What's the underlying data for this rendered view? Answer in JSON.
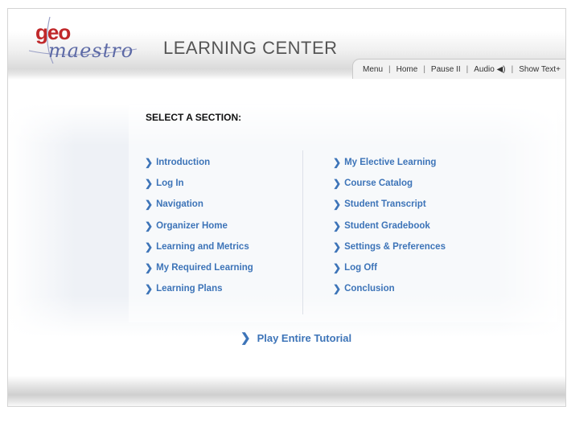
{
  "logo": {
    "geo": "geo",
    "maestro": "maestro"
  },
  "header": {
    "title": "LEARNING CENTER"
  },
  "nav": {
    "menu": "Menu",
    "home": "Home",
    "pause": "Pause II",
    "audio": "Audio ◀)",
    "show_text": "Show Text+"
  },
  "sections": {
    "heading": "SELECT A SECTION:",
    "left": [
      "Introduction",
      "Log In",
      "Navigation",
      "Organizer Home",
      "Learning and Metrics",
      "My Required Learning",
      "Learning Plans"
    ],
    "right": [
      "My Elective Learning",
      "Course Catalog",
      "Student Transcript",
      "Student Gradebook",
      "Settings & Preferences",
      "Log Off",
      "Conclusion"
    ]
  },
  "play": {
    "label": "Play Entire Tutorial"
  },
  "colors": {
    "link": "#3d74b8",
    "logo_red": "#c0282a",
    "logo_purple": "#5d6aa6"
  }
}
